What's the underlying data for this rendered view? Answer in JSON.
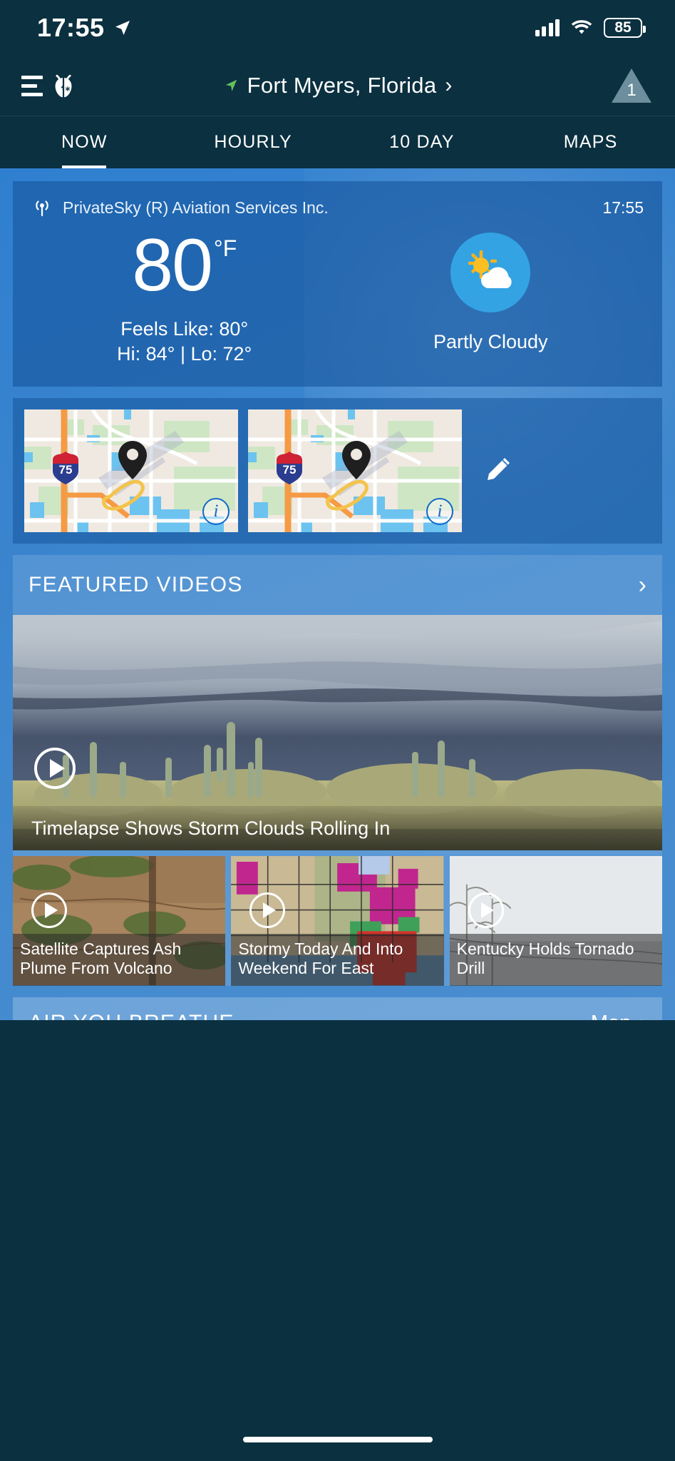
{
  "status_bar": {
    "time": "17:55",
    "location_arrow_icon": "location-arrow-icon",
    "signal_icon": "cellular-signal-icon",
    "wifi_icon": "wifi-icon",
    "battery_level": "85"
  },
  "nav": {
    "menu_icon": "hamburger-menu-icon",
    "logo_icon": "weatherbug-logo-icon",
    "location_arrow_icon": "location-arrow-icon",
    "location": "Fort Myers, Florida",
    "location_chevron": "›",
    "alert_count": "1",
    "alert_icon": "alert-triangle-icon"
  },
  "tabs": [
    {
      "label": "NOW",
      "active": true
    },
    {
      "label": "HOURLY",
      "active": false
    },
    {
      "label": "10 DAY",
      "active": false
    },
    {
      "label": "MAPS",
      "active": false
    }
  ],
  "current": {
    "station_icon": "broadcast-station-icon",
    "station": "PrivateSky (R) Aviation Services Inc.",
    "observed_time": "17:55",
    "temperature": "80",
    "unit": "°F",
    "feels_like": "Feels Like: 80°",
    "hi_lo": "Hi: 84° | Lo: 72°",
    "condition": "Partly Cloudy",
    "condition_icon": "partly-cloudy-icon"
  },
  "maps": {
    "thumbnails": [
      {
        "label": "map-thumbnail-1",
        "highway_shield": "75",
        "info_icon": "info-icon",
        "pin_icon": "map-pin-icon"
      },
      {
        "label": "map-thumbnail-2",
        "highway_shield": "75",
        "info_icon": "info-icon",
        "pin_icon": "map-pin-icon"
      }
    ],
    "edit_icon": "pencil-edit-icon"
  },
  "featured_videos": {
    "title": "FEATURED VIDEOS",
    "more_chevron": "›",
    "play_icon": "play-icon",
    "hero": {
      "title": "Timelapse Shows Storm Clouds Rolling In"
    },
    "tiles": [
      {
        "title": "Satellite Captures Ash Plume From Volcano"
      },
      {
        "title": "Stormy Today And Into Weekend For East"
      },
      {
        "title": "Kentucky Holds Tornado Drill"
      }
    ]
  },
  "air_quality": {
    "title": "AIR YOU BREATHE",
    "map_link": "Map",
    "map_chevron": "›"
  },
  "colors": {
    "header_bg": "#0b3040",
    "accent_blue": "#3d86cd",
    "card_blue": "#16559c",
    "icon_sky": "#33a3e3",
    "sun_yellow": "#f5b21f"
  }
}
